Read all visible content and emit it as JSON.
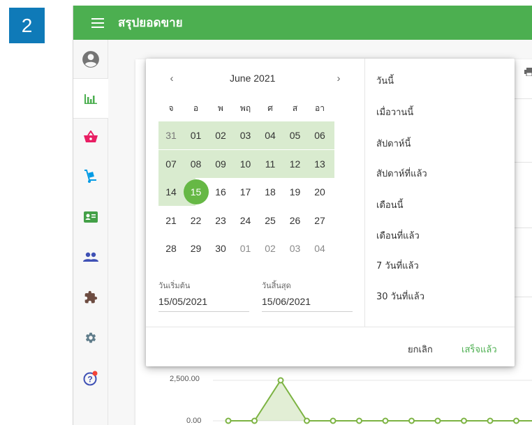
{
  "step_badge": "2",
  "topbar": {
    "title": "สรุปยอดขาย"
  },
  "sidebar": {
    "items": [
      {
        "name": "user",
        "icon": "account-circle-icon",
        "color": "#757575"
      },
      {
        "name": "reports",
        "icon": "bar-chart-icon",
        "color": "#4caf50",
        "active": true
      },
      {
        "name": "sales",
        "icon": "shopping-basket-icon",
        "color": "#e91e63"
      },
      {
        "name": "delivery",
        "icon": "hand-truck-icon",
        "color": "#039be5"
      },
      {
        "name": "members",
        "icon": "contact-card-icon",
        "color": "#43a047"
      },
      {
        "name": "users",
        "icon": "people-icon",
        "color": "#3f51b5"
      },
      {
        "name": "plugins",
        "icon": "puzzle-icon",
        "color": "#6d4c41"
      },
      {
        "name": "settings",
        "icon": "gear-icon",
        "color": "#607d8b"
      },
      {
        "name": "help",
        "icon": "help-icon",
        "color": "#3f51b5",
        "notification_dot": "#f44336"
      }
    ]
  },
  "chart": {
    "y_ticks": [
      "2,500.00",
      "0.00"
    ],
    "values": [
      0,
      0,
      2500,
      0,
      0,
      0,
      0,
      0,
      0,
      0,
      0,
      0,
      0,
      0,
      0
    ]
  },
  "date_picker": {
    "month_label": "June 2021",
    "prev_label": "‹",
    "next_label": "›",
    "weekdays": [
      "จ",
      "อ",
      "พ",
      "พฤ",
      "ศ",
      "ส",
      "อา"
    ],
    "weeks": [
      [
        "31",
        "01",
        "02",
        "03",
        "04",
        "05",
        "06"
      ],
      [
        "07",
        "08",
        "09",
        "10",
        "11",
        "12",
        "13"
      ],
      [
        "14",
        "15",
        "16",
        "17",
        "18",
        "19",
        "20"
      ],
      [
        "21",
        "22",
        "23",
        "24",
        "25",
        "26",
        "27"
      ],
      [
        "28",
        "29",
        "30",
        "01",
        "02",
        "03",
        "04"
      ]
    ],
    "selected_day": "15",
    "start": {
      "label": "วันเริ่มต้น",
      "value": "15/05/2021"
    },
    "end": {
      "label": "วันสิ้นสุด",
      "value": "15/06/2021"
    },
    "presets": [
      "วันนี้",
      "เมื่อวานนี้",
      "สัปดาห์นี้",
      "สัปดาห์ที่แล้ว",
      "เดือนนี้",
      "เดือนที่แล้ว",
      "7 วันที่แล้ว",
      "30 วันที่แล้ว"
    ],
    "cancel_label": "ยกเลิก",
    "done_label": "เสร็จแล้ว",
    "accent": "#66b845",
    "range_color": "#d9ebcf"
  }
}
